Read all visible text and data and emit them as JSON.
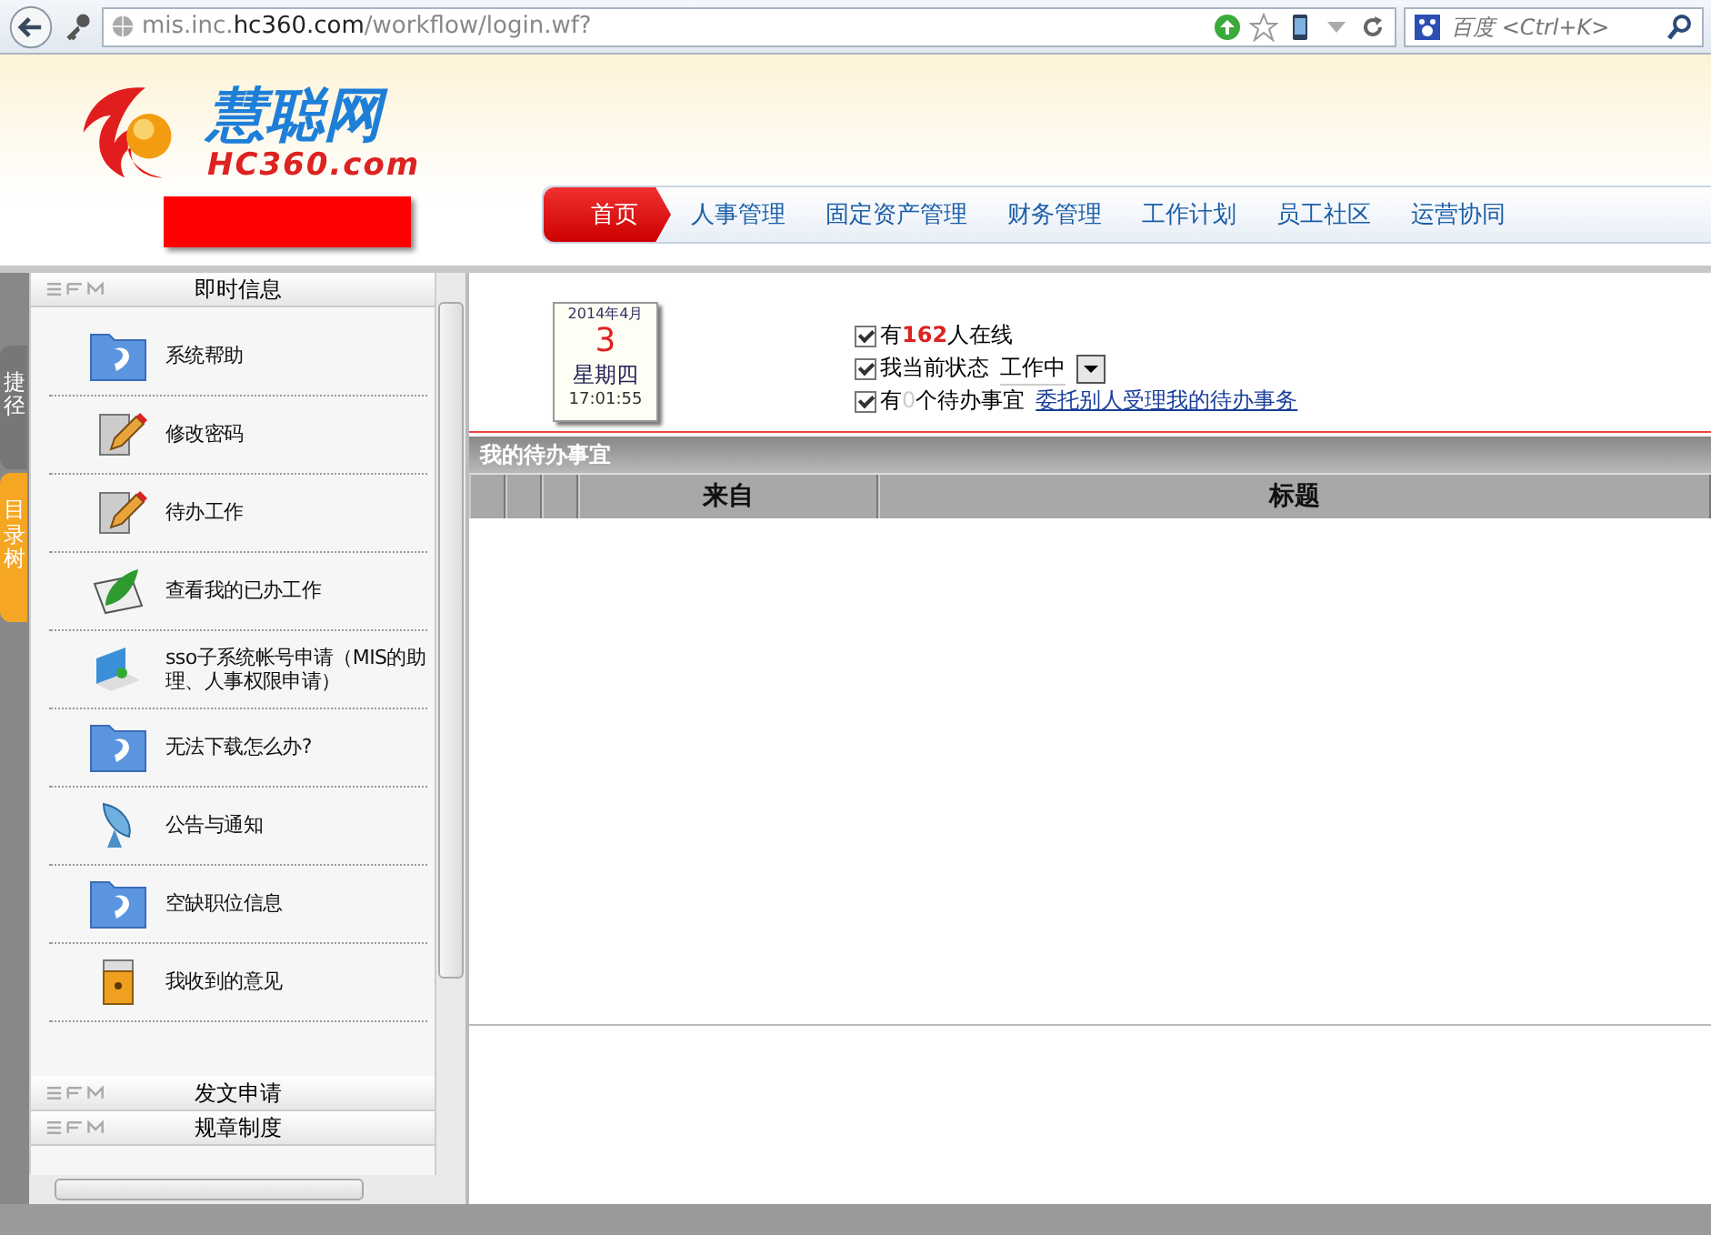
{
  "browser": {
    "url": "mis.inc.**hc360.com**/workflow/login.wf?",
    "search_placeholder": "百度 <Ctrl+K>"
  },
  "logo": {
    "title": "慧聪网",
    "subtitle": "HC360.com"
  },
  "nav": [
    {
      "label": "首页",
      "selected": true
    },
    {
      "label": "人事管理",
      "selected": false
    },
    {
      "label": "固定资产管理",
      "selected": false
    },
    {
      "label": "财务管理",
      "selected": false
    },
    {
      "label": "工作计划",
      "selected": false
    },
    {
      "label": "员工社区",
      "selected": false
    },
    {
      "label": "运营协同",
      "selected": false
    }
  ],
  "side_tabs": [
    {
      "label": "捷径",
      "selected": false
    },
    {
      "label": "目录树",
      "selected": true
    }
  ],
  "sidebar": [
    {
      "title": "即时信息",
      "items": [
        {
          "label": "系统帮助",
          "kind": "folder"
        },
        {
          "label": "修改密码",
          "kind": "edit"
        },
        {
          "label": "待办工作",
          "kind": "edit"
        },
        {
          "label": "查看我的已办工作",
          "kind": "leaf"
        },
        {
          "label": "sso子系统帐号申请（MIS的助理、人事权限申请）",
          "kind": "monitor"
        },
        {
          "label": "无法下载怎么办?",
          "kind": "folder"
        },
        {
          "label": "公告与通知",
          "kind": "dish"
        },
        {
          "label": "空缺职位信息",
          "kind": "folder"
        },
        {
          "label": "我收到的意见",
          "kind": "lock"
        }
      ]
    },
    {
      "title": "发文申请"
    },
    {
      "title": "规章制度"
    }
  ],
  "calendar": {
    "month": "2014年4月",
    "day": "3",
    "weekday": "星期四",
    "time": "17:01:55"
  },
  "status": {
    "online": {
      "checked": true,
      "text": "有**162**人在线"
    },
    "state": {
      "checked": true,
      "label": "我当前状态",
      "value": "工作中"
    },
    "todo": {
      "checked": true,
      "prefix": "有",
      "count": "0",
      "suffix": "个待办事宜",
      "link": "委托别人受理我的待办事务"
    }
  },
  "todo_panel": {
    "title": "我的待办事宜",
    "columns": [
      {
        "label": "来自"
      },
      {
        "label": "标题"
      }
    ]
  }
}
